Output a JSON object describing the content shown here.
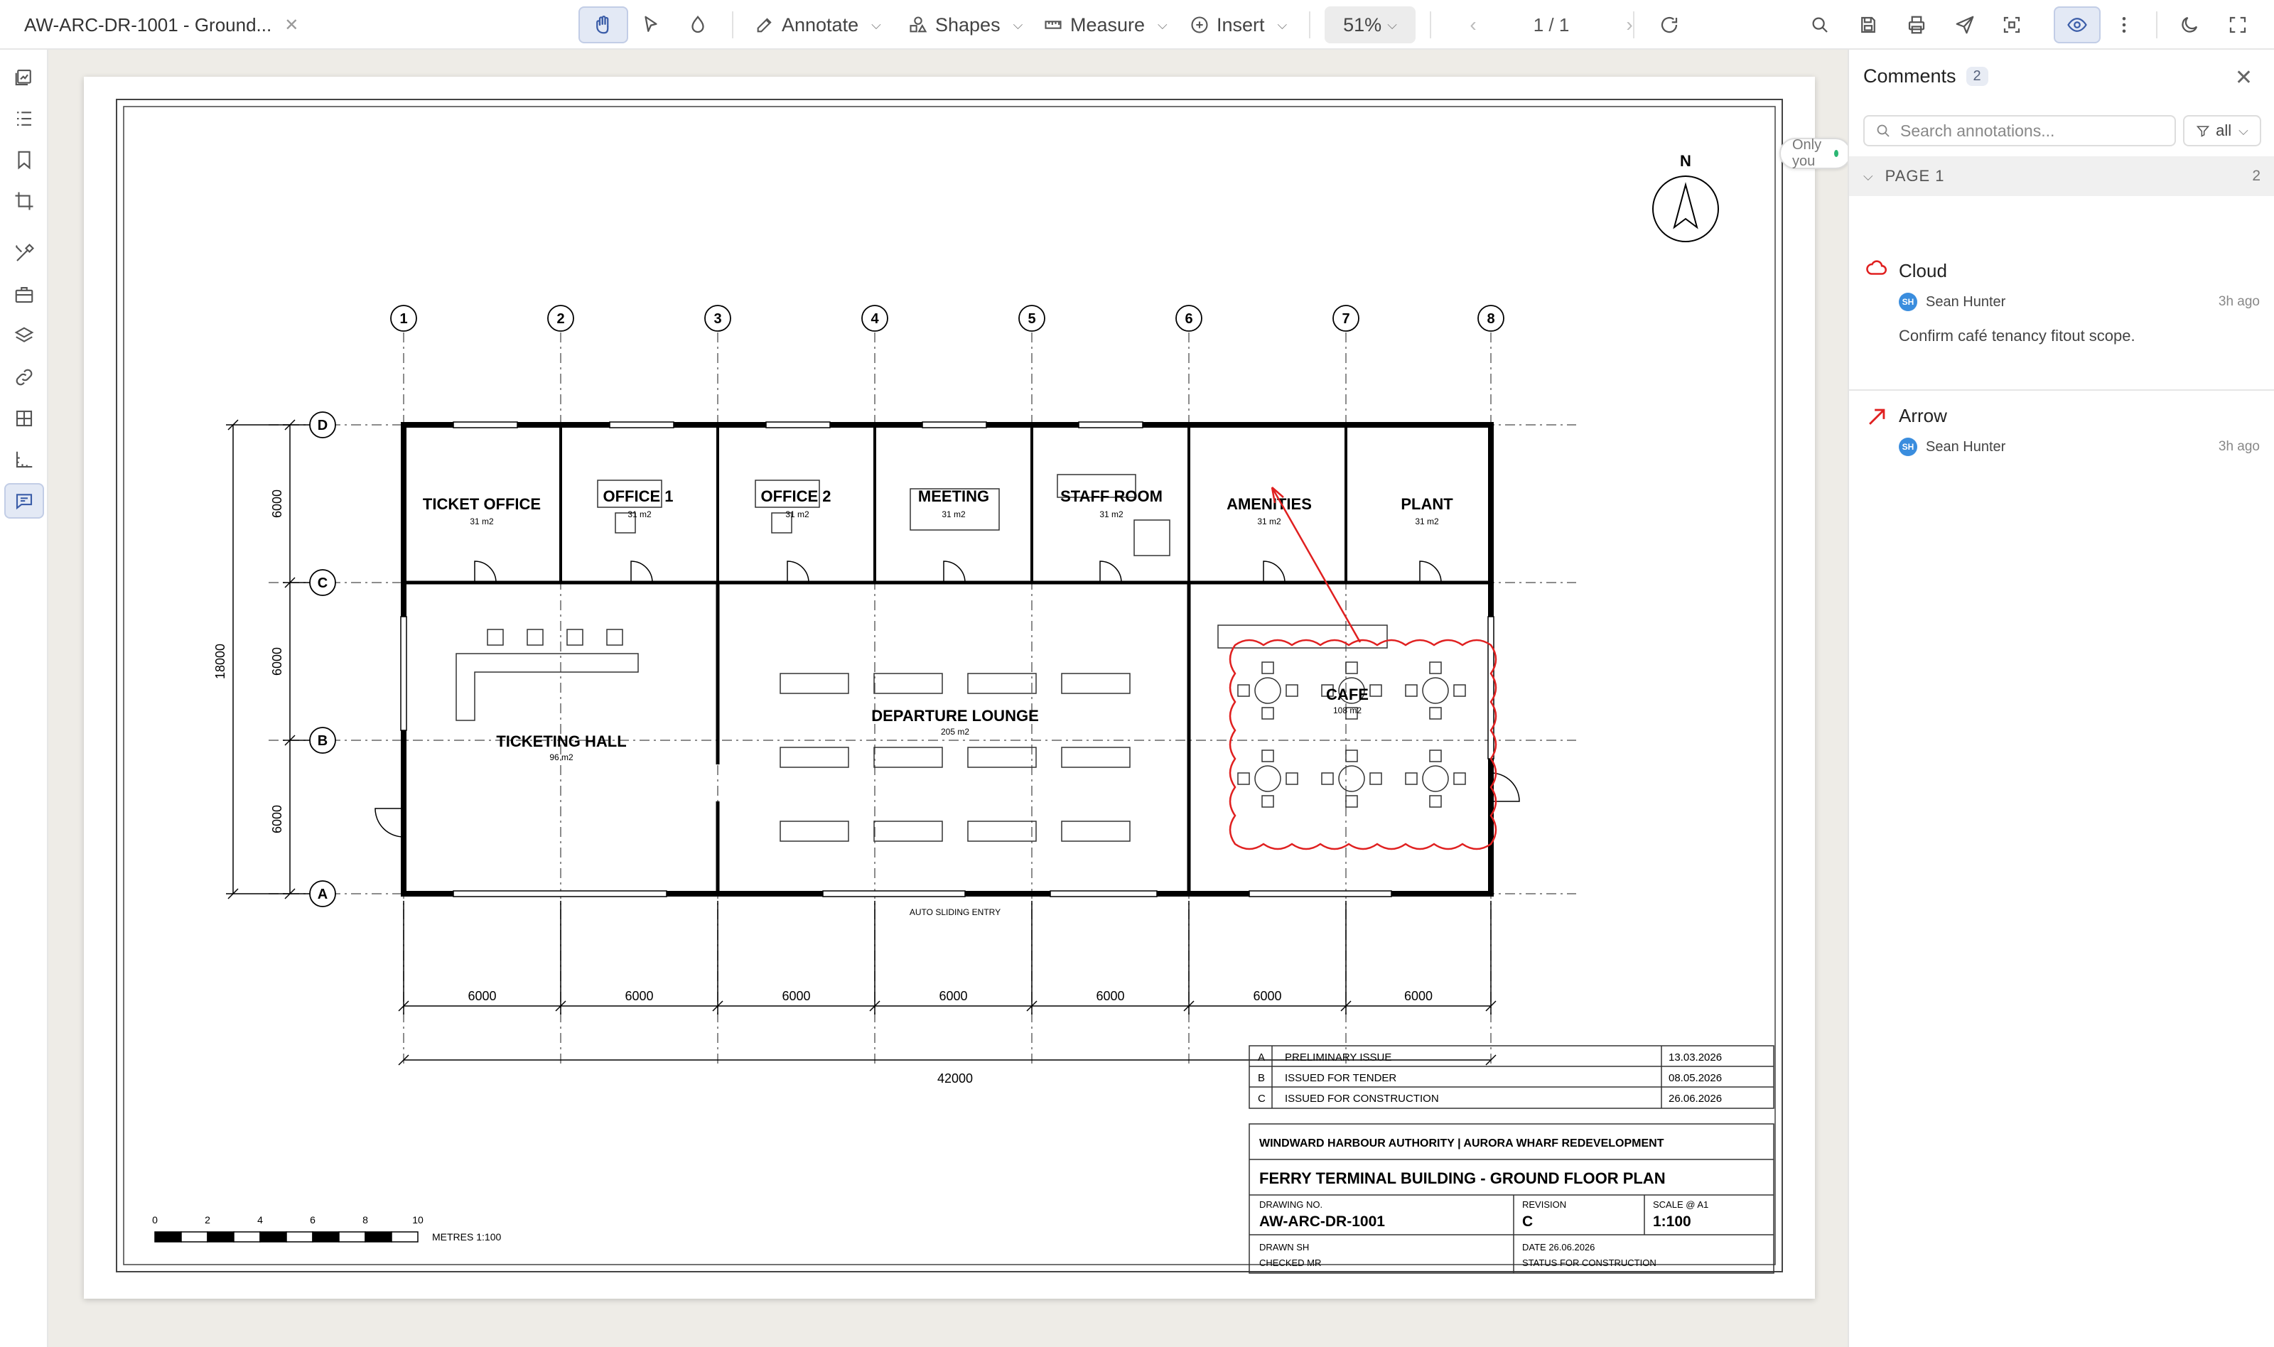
{
  "document": {
    "tab_title": "AW-ARC-DR-1001 - Ground..."
  },
  "toolbar": {
    "annotate_label": "Annotate",
    "shapes_label": "Shapes",
    "measure_label": "Measure",
    "insert_label": "Insert",
    "zoom_level": "51%",
    "page_indicator": "1 / 1"
  },
  "status": {
    "visibility_label": "Only you"
  },
  "drawing": {
    "grid_columns": [
      "1",
      "2",
      "3",
      "4",
      "5",
      "6",
      "7",
      "8"
    ],
    "grid_rows": [
      "D",
      "C",
      "B",
      "A"
    ],
    "rooms": [
      {
        "name": "TICKET OFFICE",
        "area": "31 m2"
      },
      {
        "name": "OFFICE 1",
        "area": "31 m2"
      },
      {
        "name": "OFFICE 2",
        "area": "31 m2"
      },
      {
        "name": "MEETING",
        "area": "31 m2"
      },
      {
        "name": "STAFF ROOM",
        "area": "31 m2"
      },
      {
        "name": "AMENITIES",
        "area": "31 m2"
      },
      {
        "name": "PLANT",
        "area": "31 m2"
      },
      {
        "name": "TICKETING HALL",
        "area": "96 m2"
      },
      {
        "name": "DEPARTURE LOUNGE",
        "area": "205 m2"
      },
      {
        "name": "CAFE",
        "area": "108 m2"
      }
    ],
    "entry_label": "AUTO SLIDING ENTRY",
    "bay_dimensions": [
      "6000",
      "6000",
      "6000",
      "6000",
      "6000",
      "6000",
      "6000"
    ],
    "overall_dimension": "42000",
    "vertical_dimensions": [
      "6000",
      "6000",
      "6000"
    ],
    "overall_height": "18000",
    "north_label": "N",
    "scale_bar": {
      "ticks": [
        "0",
        "2",
        "4",
        "6",
        "8",
        "10"
      ],
      "label": "METRES  1:100"
    },
    "revisions": [
      {
        "rev": "A",
        "description": "PRELIMINARY ISSUE",
        "date": "13.03.2026"
      },
      {
        "rev": "B",
        "description": "ISSUED FOR TENDER",
        "date": "08.05.2026"
      },
      {
        "rev": "C",
        "description": "ISSUED FOR CONSTRUCTION",
        "date": "26.06.2026"
      }
    ],
    "title_block": {
      "client": "WINDWARD HARBOUR AUTHORITY | AURORA WHARF REDEVELOPMENT",
      "title": "FERRY TERMINAL BUILDING - GROUND FLOOR PLAN",
      "drawing_no_label": "DRAWING NO.",
      "drawing_no": "AW-ARC-DR-1001",
      "revision_label": "REVISION",
      "revision": "C",
      "scale_label": "SCALE @ A1",
      "scale": "1:100",
      "drawn": "DRAWN  SH",
      "checked": "CHECKED  MR",
      "date": "DATE  26.06.2026",
      "status": "STATUS  FOR CONSTRUCTION"
    }
  },
  "comments_panel": {
    "title": "Comments",
    "count": "2",
    "search_placeholder": "Search annotations...",
    "filter_label": "all",
    "page_group": {
      "label": "PAGE 1",
      "count": "2"
    },
    "annotations": [
      {
        "type": "Cloud",
        "author": "Sean Hunter",
        "initials": "SH",
        "time": "3h ago",
        "text": "Confirm café tenancy fitout scope.",
        "color": "#e02020"
      },
      {
        "type": "Arrow",
        "author": "Sean Hunter",
        "initials": "SH",
        "time": "3h ago",
        "text": "",
        "color": "#e02020"
      }
    ]
  }
}
